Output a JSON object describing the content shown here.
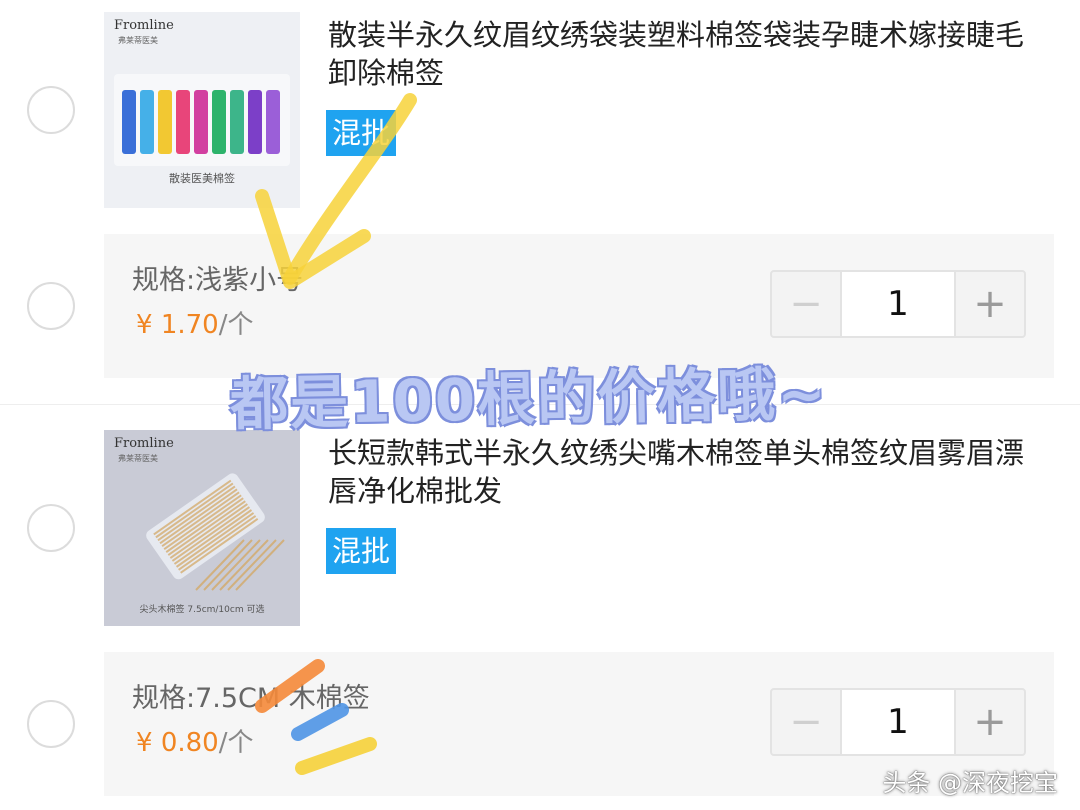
{
  "items": [
    {
      "thumb": {
        "brand": "Fromline",
        "brand_sub": "弗莱蒂医美",
        "caption": "散装医美棉签",
        "colors": [
          "#3a6fd8",
          "#45b0e8",
          "#f2c832",
          "#e8457a",
          "#d23fa0",
          "#2db36b",
          "#3db58a",
          "#7c3fc8",
          "#9b5fd8"
        ]
      },
      "title": "散装半永久纹眉纹绣袋装塑料棉签袋装孕睫术嫁接睫毛卸除棉签",
      "tag": "混批",
      "spec": "规格:浅紫小号",
      "price_symbol": "¥",
      "price": "1.70",
      "price_unit": "/个",
      "quantity": "1",
      "minus": "−",
      "plus": "+"
    },
    {
      "thumb": {
        "brand": "Fromline",
        "brand_sub": "弗莱蒂医美",
        "caption": "尖头木棉签 7.5cm/10cm 可选"
      },
      "title": "长短款韩式半永久纹绣尖嘴木棉签单头棉签纹眉雾眉漂唇净化棉批发",
      "tag": "混批",
      "spec": "规格:7.5CM 木棉签",
      "price_symbol": "¥",
      "price": "0.80",
      "price_unit": "/个",
      "quantity": "1",
      "minus": "−",
      "plus": "+"
    }
  ],
  "overlay_note": "都是100根的价格哦~",
  "watermark": "头条 @深夜挖宝",
  "colors": {
    "accent_tag": "#1fa3f0",
    "price": "#f08522",
    "highlight_yellow": "#f7d23a",
    "highlight_orange": "#f58a3a",
    "highlight_blue": "#4f95e6"
  }
}
